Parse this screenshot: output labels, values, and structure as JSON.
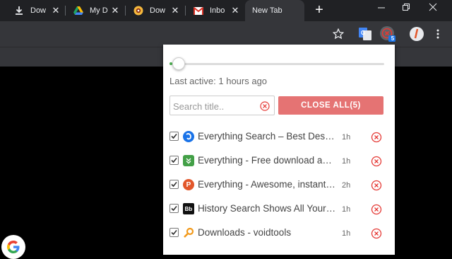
{
  "tabs": [
    {
      "title": "Dow",
      "icon": "download-icon"
    },
    {
      "title": "My D",
      "icon": "google-drive-icon"
    },
    {
      "title": "Dow",
      "icon": "download-site-icon"
    },
    {
      "title": "Inbo",
      "icon": "gmail-icon"
    },
    {
      "title": "New Tab",
      "active": true
    }
  ],
  "toolbar": {
    "extension_badge": "5",
    "icons": [
      "star-icon",
      "google-translate-icon",
      "tab-manager-extension-icon",
      "profile-icon",
      "menu-icon"
    ]
  },
  "popup": {
    "last_active": "Last active: 1 hours ago",
    "search_placeholder": "Search title..",
    "close_all_label": "CLOSE ALL(5)",
    "slider_level": 0,
    "items": [
      {
        "title": "Everything Search – Best Desktop Search Software",
        "time": "1h",
        "checked": true,
        "icon": "everything-search-icon",
        "color": "#1a73e8"
      },
      {
        "title": "Everything - Free download and software reviews",
        "time": "1h",
        "checked": true,
        "icon": "download-arrow-icon",
        "color": "#43a047"
      },
      {
        "title": "Everything - Awesome, instant computer search",
        "time": "2h",
        "checked": true,
        "icon": "letter-p-icon",
        "color": "#e2572b"
      },
      {
        "title": "History Search Shows All Your Browsing",
        "time": "1h",
        "checked": true,
        "icon": "letter-b-icon",
        "color": "#111111"
      },
      {
        "title": "Downloads - voidtools",
        "time": "1h",
        "checked": true,
        "icon": "magnifier-icon",
        "color": "#f29a1c"
      }
    ]
  },
  "colors": {
    "close_all": "#e57373",
    "close_icon": "#e53935",
    "toolbar": "#35363a",
    "tabstrip": "#202124"
  }
}
